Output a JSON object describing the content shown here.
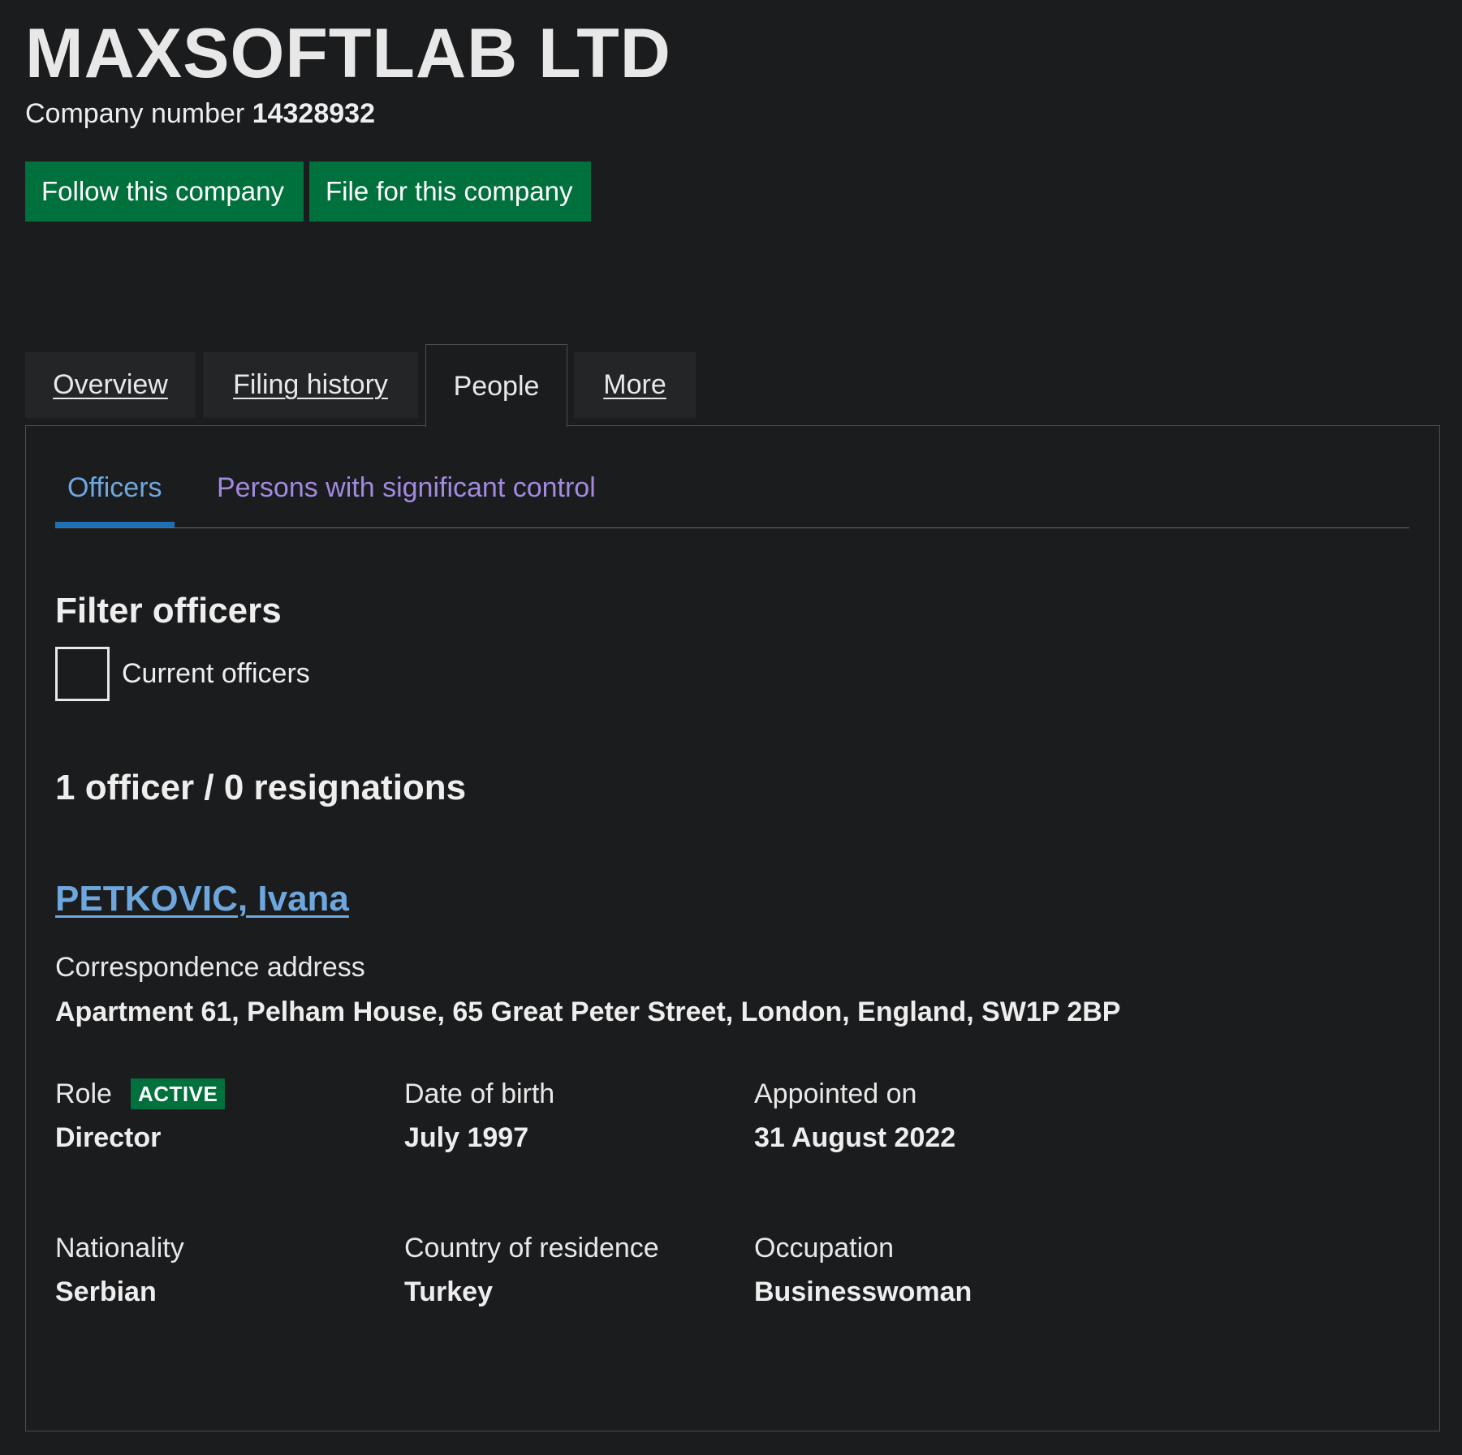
{
  "company": {
    "name": "MAXSOFTLAB LTD",
    "number_label": "Company number",
    "number": "14328932"
  },
  "actions": {
    "follow_label": "Follow this company",
    "file_label": "File for this company"
  },
  "tabs": [
    {
      "label": "Overview",
      "active": false
    },
    {
      "label": "Filing history",
      "active": false
    },
    {
      "label": "People",
      "active": true
    },
    {
      "label": "More",
      "active": false
    }
  ],
  "subtabs": [
    {
      "label": "Officers",
      "active": true
    },
    {
      "label": "Persons with significant control",
      "active": false
    }
  ],
  "filter": {
    "heading": "Filter officers",
    "checkbox_label": "Current officers",
    "checked": false
  },
  "summary": "1 officer / 0 resignations",
  "officer": {
    "name": "PETKOVIC, Ivana",
    "address_label": "Correspondence address",
    "address": "Apartment 61, Pelham House, 65 Great Peter Street, London, England, SW1P 2BP",
    "role_label": "Role",
    "status_badge": "ACTIVE",
    "role": "Director",
    "dob_label": "Date of birth",
    "dob": "July 1997",
    "appointed_label": "Appointed on",
    "appointed": "31 August 2022",
    "nationality_label": "Nationality",
    "nationality": "Serbian",
    "residence_label": "Country of residence",
    "residence": "Turkey",
    "occupation_label": "Occupation",
    "occupation": "Businesswoman"
  },
  "colors": {
    "background": "#1b1c1e",
    "button_green": "#00703c",
    "link_blue": "#6ea7dd",
    "visited_purple": "#a389e0",
    "active_tab_underline": "#1d70b8"
  }
}
